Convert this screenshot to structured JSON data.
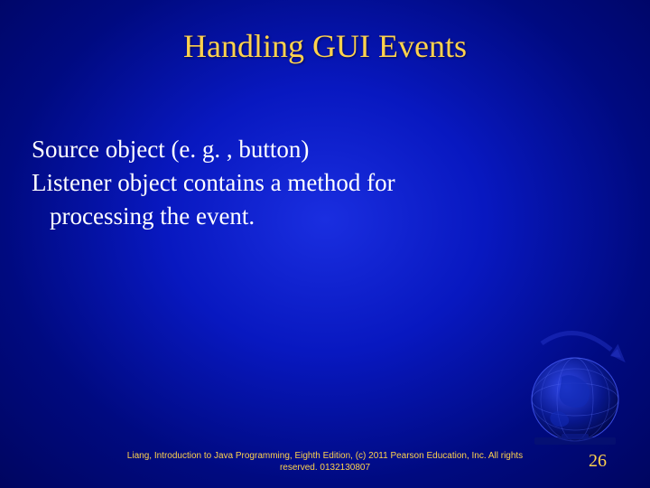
{
  "title": "Handling GUI Events",
  "body": {
    "line1": "Source object (e. g. , button)",
    "line2a": "Listener object contains a method for",
    "line2b": "processing the event."
  },
  "footer": "Liang, Introduction to Java Programming, Eighth Edition, (c) 2011 Pearson Education, Inc. All rights reserved. 0132130807",
  "page_number": "26",
  "colors": {
    "accent": "#FFD24D",
    "bg_center": "#1a2ee0",
    "bg_edge": "#000560"
  }
}
